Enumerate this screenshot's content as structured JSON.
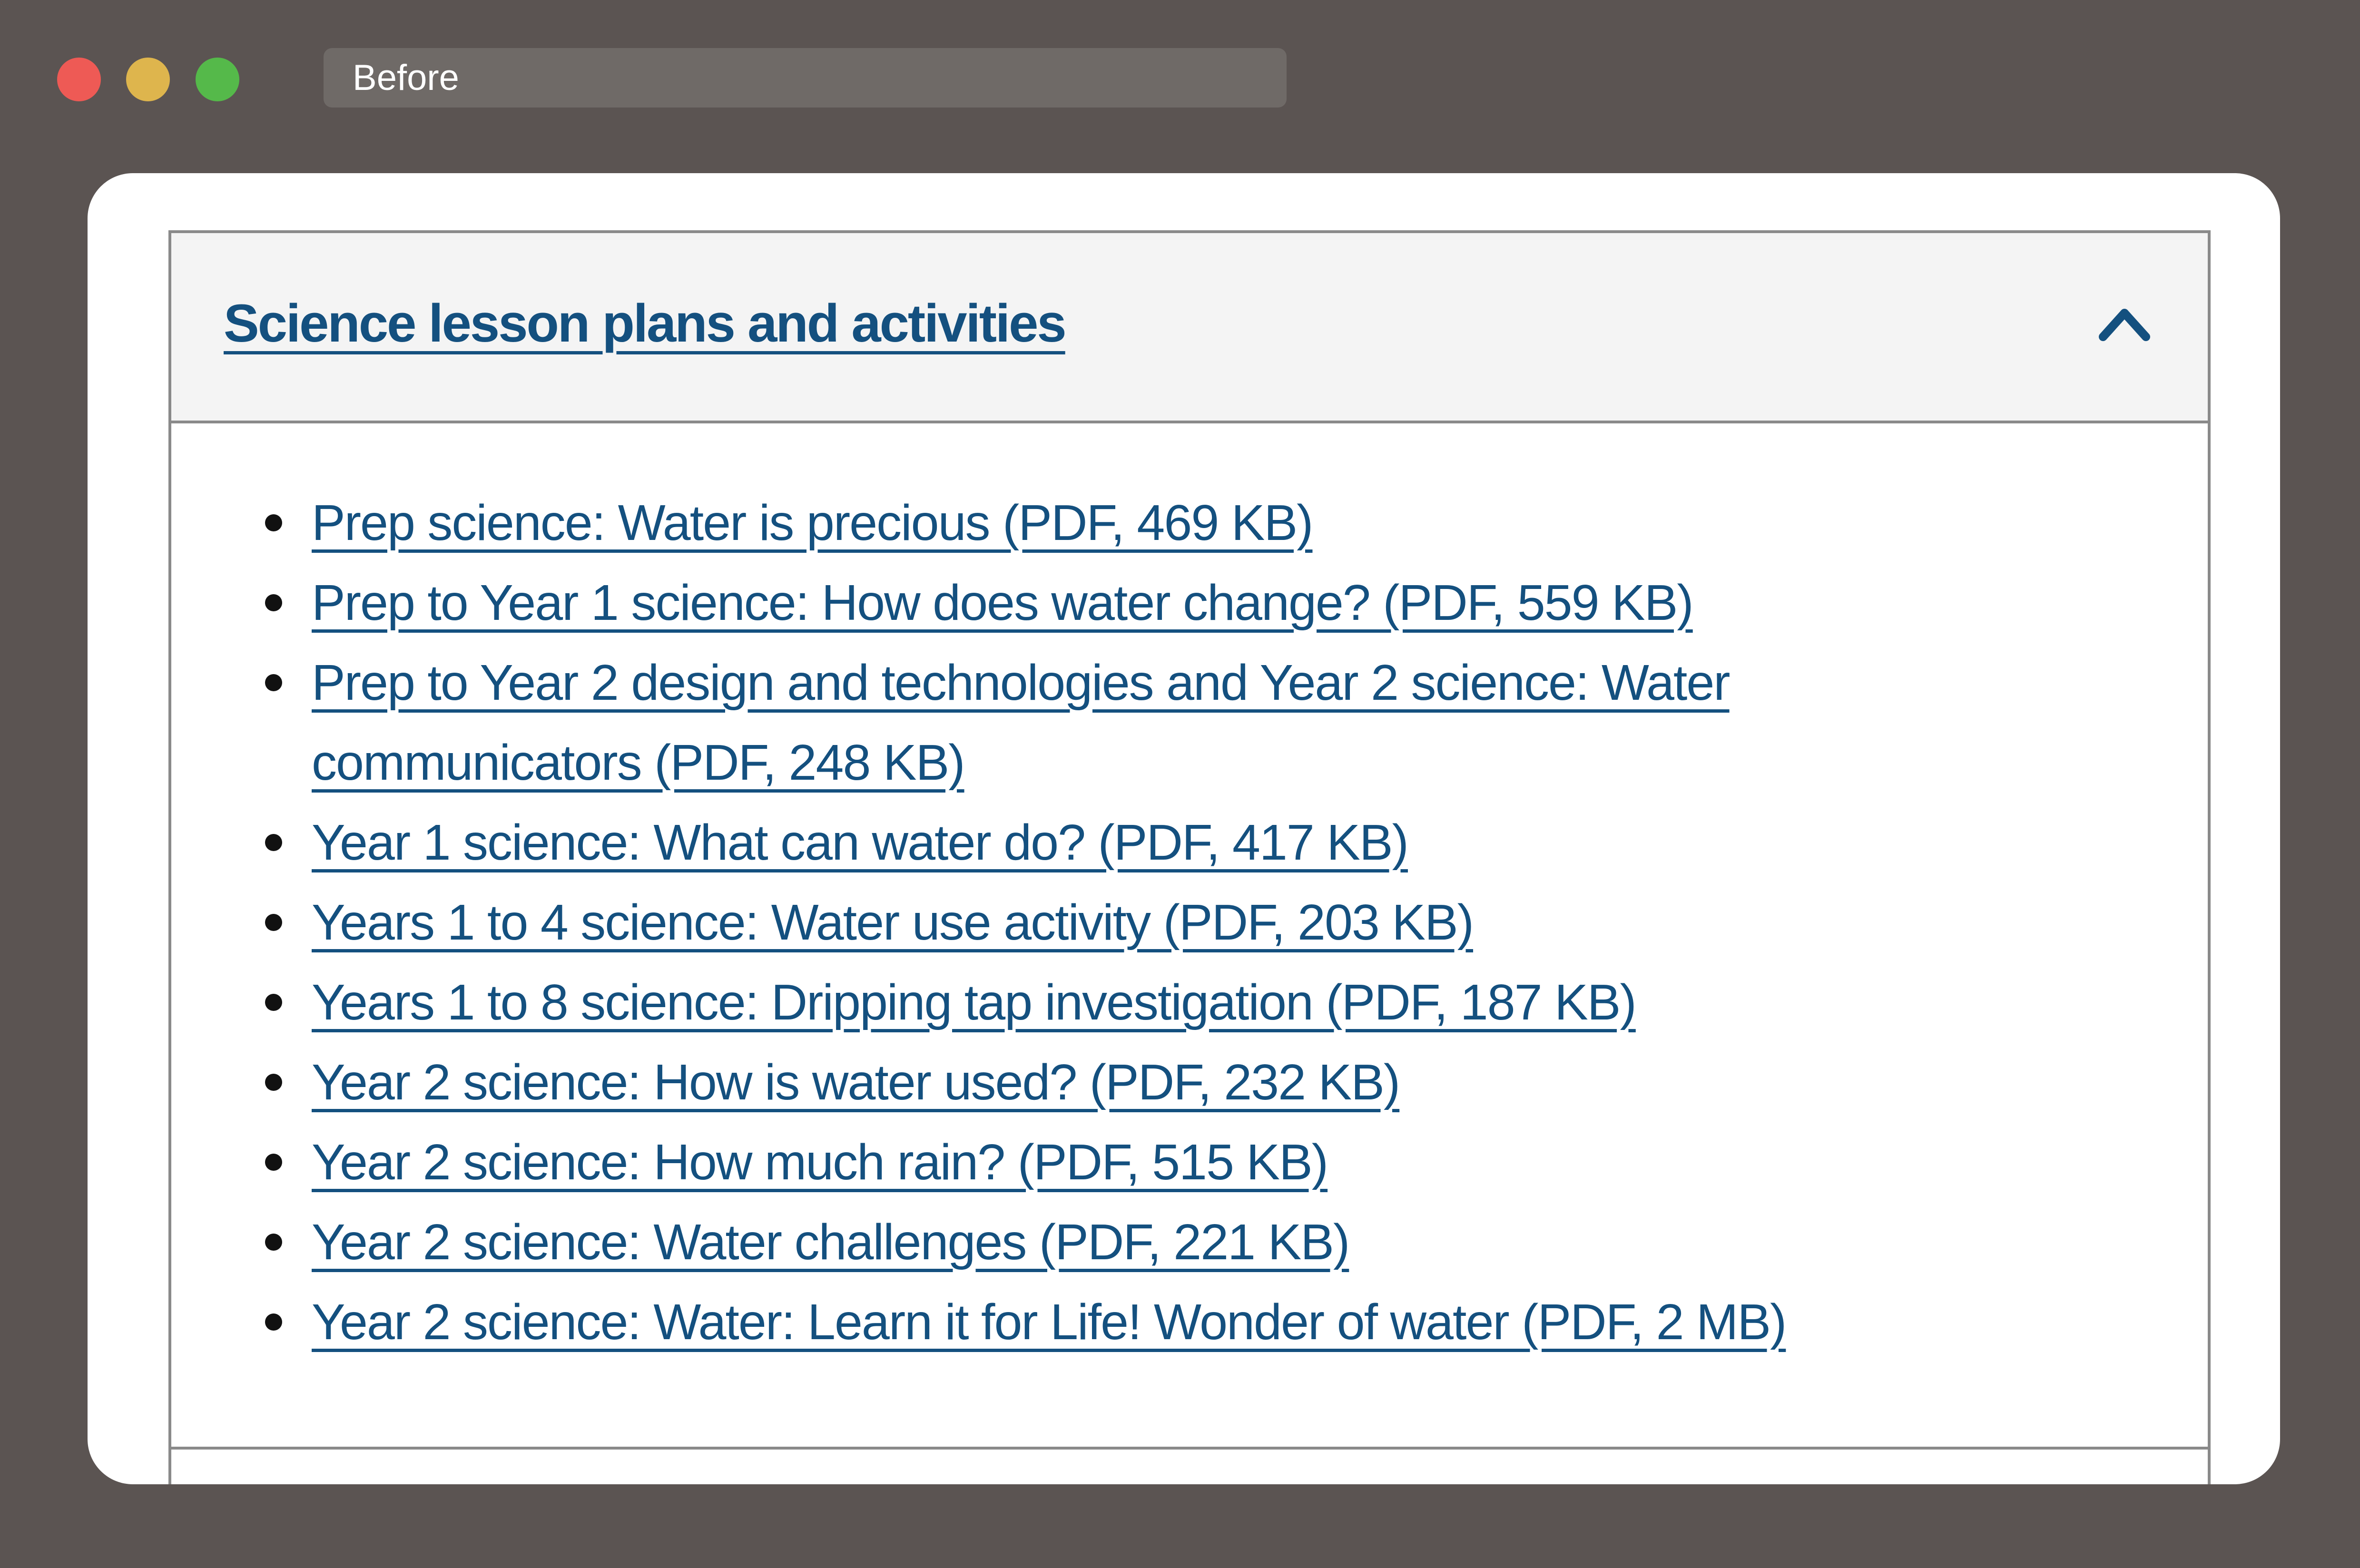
{
  "window": {
    "tab_title": "Before"
  },
  "accordion": {
    "title": "Science lesson plans and activities",
    "toggle_icon": "chevron-up-icon",
    "links": [
      "Prep science: Water is precious (PDF, 469 KB)",
      "Prep to Year 1 science: How does water change? (PDF, 559 KB)",
      "Prep to Year 2 design and technologies and Year 2 science: Water communicators (PDF, 248 KB)",
      "Year 1 science: What can water do? (PDF, 417 KB)",
      "Years 1 to 4 science: Water use activity (PDF, 203 KB)",
      "Years 1 to 8 science: Dripping tap investigation (PDF, 187 KB)",
      "Year 2 science: How is water used? (PDF, 232 KB)",
      "Year 2 science: How much rain? (PDF, 515 KB)",
      "Year 2 science: Water challenges (PDF, 221 KB)",
      "Year 2 science: Water: Learn it for Life! Wonder of water (PDF, 2 MB)"
    ]
  },
  "colors": {
    "background": "#5b5452",
    "link": "#14507f",
    "header_bg": "#f4f4f4",
    "close_button": "#ee5a55",
    "minimize_button": "#deb54d",
    "zoom_button": "#55b94a"
  }
}
